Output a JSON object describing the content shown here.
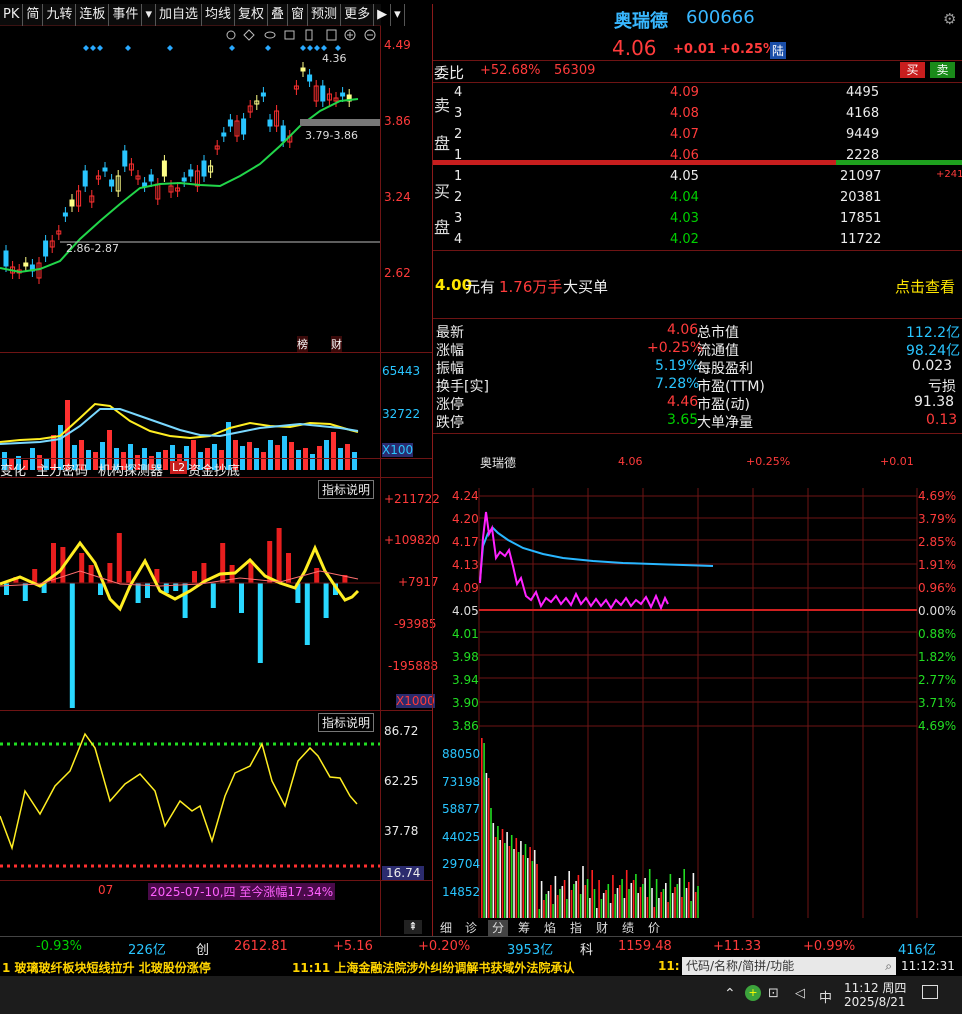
{
  "toolbar": {
    "items": [
      "PK",
      "简",
      "九转",
      "连板",
      "事件",
      "▾",
      "加自选",
      "均线",
      "复权",
      "叠",
      "窗",
      "预测",
      "更多",
      "▶",
      "▾"
    ]
  },
  "kline": {
    "axis": [
      "4.49",
      "3.86",
      "3.24",
      "2.62"
    ],
    "high_label": "4.36",
    "range_high": "3.79-3.86",
    "range_low": "2.86-2.87",
    "tags": [
      "榜",
      "财"
    ]
  },
  "volume": {
    "axis": [
      "65443",
      "32722",
      "X100"
    ]
  },
  "ind_tabs": [
    "变化",
    "主力密码",
    "机构探测器",
    "L2",
    "资金抄底"
  ],
  "macd": {
    "explain": "指标说明",
    "axis": [
      "+211722",
      "+109820",
      "+7917",
      "-93985",
      "-195888",
      "X1000"
    ]
  },
  "kdj": {
    "explain": "指标说明",
    "axis": [
      "86.72",
      "62.25",
      "37.78",
      "16.74"
    ],
    "date_label": "07",
    "range_note": "2025-07-10,四 至今涨幅17.34%"
  },
  "stock": {
    "name": "奥瑞德",
    "code": "600666",
    "price": "4.06",
    "change": "+0.01",
    "pct": "+0.25%",
    "badge": "陆"
  },
  "weibi": {
    "label": "委比",
    "ratio": "+52.68%",
    "diff": "56309",
    "buy_btn": "买",
    "sell_btn": "卖"
  },
  "asks": [
    {
      "n": "4",
      "p": "4.09",
      "v": "4495"
    },
    {
      "n": "3",
      "p": "4.08",
      "v": "4168"
    },
    {
      "n": "2",
      "p": "4.07",
      "v": "9449"
    },
    {
      "n": "1",
      "p": "4.06",
      "v": "2228"
    }
  ],
  "bids": [
    {
      "n": "1",
      "p": "4.05",
      "v": "21097",
      "d": "+241"
    },
    {
      "n": "2",
      "p": "4.04",
      "v": "20381",
      "d": ""
    },
    {
      "n": "3",
      "p": "4.03",
      "v": "17851",
      "d": ""
    },
    {
      "n": "4",
      "p": "4.02",
      "v": "11722",
      "d": ""
    }
  ],
  "side": {
    "sell1": "卖",
    "sell2": "盘",
    "buy1": "买",
    "buy2": "盘"
  },
  "bigorder": {
    "price": "4.00",
    "unit1": "元有",
    "amt": "1.76万手",
    "desc": "大买单",
    "link": "点击查看"
  },
  "info": {
    "left": [
      {
        "k": "最新",
        "v": "4.06",
        "c": "red"
      },
      {
        "k": "涨幅",
        "v": "+0.25%",
        "c": "red"
      },
      {
        "k": "振幅",
        "v": "5.19%",
        "c": "cyn"
      },
      {
        "k": "换手[实]",
        "v": "7.28%",
        "c": "cyn"
      },
      {
        "k": "涨停",
        "v": "4.46",
        "c": "red"
      },
      {
        "k": "跌停",
        "v": "3.65",
        "c": "grn"
      }
    ],
    "right": [
      {
        "k": "总市值",
        "v": "112.2亿",
        "c": "cyn"
      },
      {
        "k": "流通值",
        "v": "98.24亿",
        "c": "cyn"
      },
      {
        "k": "每股盈利",
        "v": "0.023",
        "c": "wht"
      },
      {
        "k": "市盈(TTM)",
        "v": "亏损",
        "c": "wht"
      },
      {
        "k": "市盈(动)",
        "v": "91.38",
        "c": "wht"
      },
      {
        "k": "大单净量",
        "v": "0.13",
        "c": "red"
      }
    ]
  },
  "intraday": {
    "name": "奥瑞德",
    "price": "4.06",
    "pct": "+0.25%",
    "chg": "+0.01",
    "left_axis": [
      "4.24",
      "4.20",
      "4.17",
      "4.13",
      "4.09",
      "4.05",
      "4.01",
      "3.98",
      "3.94",
      "3.90",
      "3.86"
    ],
    "right_axis": [
      "4.69%",
      "3.79%",
      "2.85%",
      "1.91%",
      "0.96%",
      "0.00%",
      "0.88%",
      "1.82%",
      "2.77%",
      "3.71%",
      "4.69%"
    ],
    "vol_axis": [
      "88050",
      "73198",
      "58877",
      "44025",
      "29704",
      "14852"
    ]
  },
  "bottom_tabs": [
    "细",
    "诊",
    "分",
    "筹",
    "焰",
    "指",
    "财",
    "绩",
    "价"
  ],
  "index_bar": {
    "pct1": "-0.93%",
    "amt1": "226亿",
    "name2": "创",
    "val2": "2612.81",
    "chg2": "+5.16",
    "pct2": "+0.20%",
    "amt2": "3953亿",
    "name3": "科",
    "val3": "1159.48",
    "chg3": "+11.33",
    "pct3": "+0.99%",
    "amt3": "416亿"
  },
  "news": {
    "n1": "1 玻璃玻纤板块短线拉升 北玻股份涨停",
    "n2": "11:11 上海金融法院涉外纠纷调解书获域外法院承认",
    "n3": "11:",
    "search": "代码/名称/简拼/功能",
    "time": "11:12:31"
  },
  "taskbar": {
    "ime": "中",
    "clock": "11:12 周四",
    "date": "2025/8/21"
  },
  "colors": {
    "up": "#ff3b3b",
    "down": "#00d000",
    "bg": "#000000",
    "grid": "#6e1414"
  }
}
